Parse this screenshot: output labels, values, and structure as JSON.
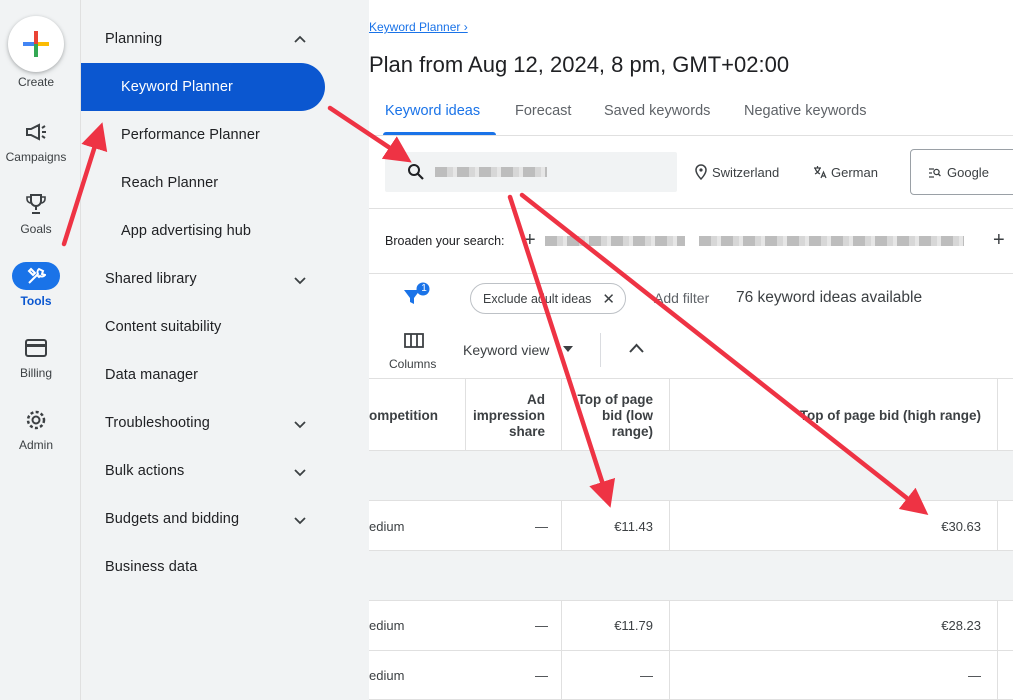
{
  "rail": {
    "create_label": "Create",
    "items": [
      {
        "label": "Campaigns",
        "icon": "megaphone-icon"
      },
      {
        "label": "Goals",
        "icon": "trophy-icon"
      },
      {
        "label": "Tools",
        "icon": "tools-icon"
      },
      {
        "label": "Billing",
        "icon": "credit-card-icon"
      },
      {
        "label": "Admin",
        "icon": "gear-icon"
      }
    ]
  },
  "nav": {
    "planning": "Planning",
    "sub_items": [
      "Keyword Planner",
      "Performance Planner",
      "Reach Planner",
      "App advertising hub"
    ],
    "sections": [
      "Shared library",
      "Content suitability",
      "Data manager",
      "Troubleshooting",
      "Bulk actions",
      "Budgets and bidding",
      "Business data"
    ]
  },
  "main": {
    "breadcrumb": "Keyword Planner ›",
    "title": "Plan from Aug 12, 2024, 8 pm, GMT+02:00",
    "tabs": [
      "Keyword ideas",
      "Forecast",
      "Saved keywords",
      "Negative keywords"
    ],
    "location": "Switzerland",
    "language": "German",
    "network": "Google",
    "broaden_label": "Broaden your search:",
    "filter_count": "1",
    "chip_label": "Exclude adult ideas",
    "add_filter": "Add filter",
    "ideas_count": "76 keyword ideas available",
    "columns_label": "Columns",
    "view_label": "Keyword view"
  },
  "table": {
    "headers": {
      "competition": "ompetition",
      "impression_share": [
        "Ad",
        "impression",
        "share"
      ],
      "low_bid": [
        "Top of page",
        "bid (low",
        "range)"
      ],
      "high_bid": "Top of page bid (high range)"
    },
    "rows": [
      {
        "competition": "edium",
        "impr": "—",
        "low": "€11.43",
        "high": "€30.63"
      },
      {
        "competition": "edium",
        "impr": "—",
        "low": "€11.79",
        "high": "€28.23"
      },
      {
        "competition": "edium",
        "impr": "—",
        "low": "—",
        "high": "—"
      }
    ]
  },
  "colors": {
    "accent": "#1a73e8",
    "active_nav": "#0b57d0",
    "arrow": "#ee3344"
  }
}
